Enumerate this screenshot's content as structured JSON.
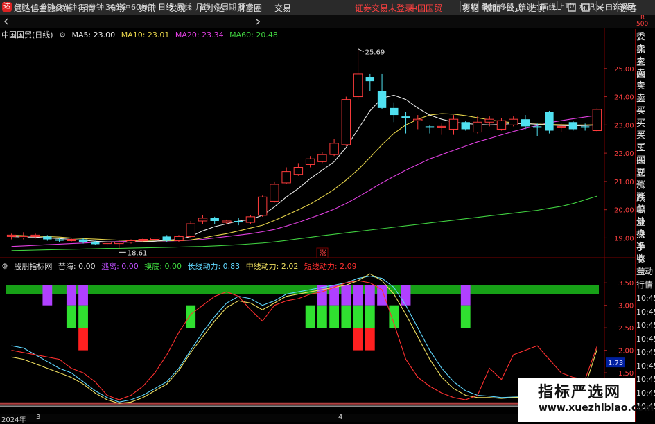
{
  "app": {
    "title": "通达信金融终端",
    "logo_text": "达"
  },
  "menu": [
    "行情",
    "市场",
    "资讯",
    "发现",
    "问小达",
    "财富圈",
    "交易"
  ],
  "menu_notice": {
    "login": "证券交易未登录",
    "stock": "中国国贸"
  },
  "menu_right": [
    "功能",
    "版面",
    "公式",
    "选项"
  ],
  "guest": "游客",
  "periods": [
    "分时",
    "1分钟",
    "5分钟",
    "15分钟",
    "30分钟",
    "60分钟",
    "日线",
    "周线",
    "月线",
    "多周期",
    "更多"
  ],
  "active_period": "日线",
  "toolbar_right": [
    "复权",
    "叠加",
    "多股",
    "统计",
    "画线",
    "F10",
    "标记",
    "+自选",
    "返回"
  ],
  "main_legend": {
    "name": "中国国贸(日线)",
    "items": [
      {
        "label": "MA5: 23.00",
        "color": "#e6e6e6"
      },
      {
        "label": "MA10: 23.01",
        "color": "#e6d34a"
      },
      {
        "label": "MA20: 23.34",
        "color": "#e040e0"
      },
      {
        "label": "MA60: 20.48",
        "color": "#40d040"
      }
    ]
  },
  "sub_legend": {
    "name": "股朋指标网",
    "items": [
      {
        "label": "苦海: 0.00",
        "color": "#d8d8d8"
      },
      {
        "label": "逃离: 0.00",
        "color": "#c050ff"
      },
      {
        "label": "摸底: 0.00",
        "color": "#40e040"
      },
      {
        "label": "长线动力: 0.83",
        "color": "#60d8ff"
      },
      {
        "label": "中线动力: 2.02",
        "color": "#f0e060"
      },
      {
        "label": "短线动力: 2.09",
        "color": "#ff3030"
      }
    ]
  },
  "right_panel": {
    "top_marks": [
      "R",
      "500"
    ],
    "items": [
      "委比",
      "卖五",
      "卖四",
      "卖三",
      "卖二",
      "卖一",
      "买一",
      "买二",
      "买三",
      "买四",
      "买五",
      "现价",
      "涨跌",
      "涨幅",
      "总量",
      "外盘",
      "换手",
      "净资",
      "收益"
    ],
    "bottom_items": [
      "自动",
      "行情"
    ],
    "times": [
      "10:45",
      "10:45",
      "10:45",
      "10:45",
      "10:45",
      "10:45",
      "10:45",
      "10:45",
      "10:45"
    ]
  },
  "price_axis": {
    "ticks": [
      "25.00",
      "24.00",
      "23.00",
      "22.00",
      "21.00",
      "20.00",
      "19.00"
    ],
    "min": 18.3,
    "max": 26.0
  },
  "annotations": {
    "high": "25.69",
    "low": "18.61",
    "marker": "涨"
  },
  "indicator_axis": {
    "ticks": [
      "3.50",
      "3.00",
      "2.50",
      "2.00",
      "1.50",
      "1.00"
    ],
    "min": 0.7,
    "max": 3.75,
    "current": "1.73"
  },
  "chart_data": {
    "type": "candlestick",
    "candles": [
      [
        19.05,
        19.1,
        18.95,
        19.15
      ],
      [
        19.0,
        19.05,
        18.95,
        19.2
      ],
      [
        19.05,
        19.1,
        18.98,
        19.15
      ],
      [
        19.05,
        18.95,
        18.9,
        19.1
      ],
      [
        18.95,
        18.9,
        18.85,
        19.0
      ],
      [
        18.9,
        18.95,
        18.85,
        19.0
      ],
      [
        18.95,
        18.85,
        18.8,
        19.0
      ],
      [
        18.85,
        18.78,
        18.75,
        18.9
      ],
      [
        18.8,
        18.85,
        18.7,
        18.9
      ],
      [
        18.8,
        18.85,
        18.61,
        18.9
      ],
      [
        18.85,
        18.9,
        18.8,
        18.95
      ],
      [
        18.9,
        18.95,
        18.85,
        19.0
      ],
      [
        18.95,
        19.0,
        18.9,
        19.05
      ],
      [
        19.05,
        18.9,
        18.85,
        19.1
      ],
      [
        18.9,
        19.05,
        18.85,
        19.1
      ],
      [
        19.05,
        19.5,
        19.0,
        19.6
      ],
      [
        19.6,
        19.7,
        19.5,
        19.8
      ],
      [
        19.7,
        19.6,
        19.5,
        19.75
      ],
      [
        19.55,
        19.6,
        19.5,
        19.65
      ],
      [
        19.6,
        19.55,
        19.45,
        19.7
      ],
      [
        19.55,
        19.75,
        19.5,
        19.8
      ],
      [
        19.8,
        20.45,
        19.75,
        20.5
      ],
      [
        20.3,
        20.9,
        20.25,
        21.0
      ],
      [
        20.95,
        21.35,
        20.9,
        21.5
      ],
      [
        21.25,
        21.5,
        21.2,
        21.65
      ],
      [
        21.6,
        21.8,
        21.5,
        21.9
      ],
      [
        21.7,
        21.95,
        21.65,
        22.05
      ],
      [
        21.95,
        22.35,
        21.9,
        22.5
      ],
      [
        22.3,
        23.9,
        22.25,
        24.0
      ],
      [
        24.0,
        24.8,
        23.9,
        25.69
      ],
      [
        24.7,
        24.55,
        24.2,
        24.8
      ],
      [
        24.2,
        23.6,
        23.55,
        24.8
      ],
      [
        23.6,
        23.35,
        23.1,
        23.8
      ],
      [
        23.3,
        23.25,
        22.7,
        23.45
      ],
      [
        23.15,
        23.2,
        22.85,
        23.35
      ],
      [
        22.95,
        22.9,
        22.7,
        23.0
      ],
      [
        22.9,
        22.95,
        22.65,
        23.05
      ],
      [
        22.85,
        23.2,
        22.65,
        23.35
      ],
      [
        23.1,
        22.85,
        22.8,
        23.15
      ],
      [
        22.75,
        23.1,
        22.7,
        23.3
      ],
      [
        23.1,
        23.2,
        22.95,
        23.3
      ],
      [
        22.85,
        23.15,
        22.8,
        23.25
      ],
      [
        23.0,
        23.2,
        22.95,
        23.3
      ],
      [
        23.2,
        22.95,
        22.85,
        23.35
      ],
      [
        22.95,
        22.9,
        22.6,
        23.05
      ],
      [
        23.45,
        22.8,
        22.7,
        23.5
      ],
      [
        22.9,
        22.95,
        22.75,
        23.05
      ],
      [
        23.1,
        22.85,
        22.8,
        23.15
      ],
      [
        22.95,
        22.9,
        22.8,
        23.05
      ],
      [
        22.8,
        23.55,
        22.75,
        23.6
      ]
    ],
    "candles_format": [
      "open",
      "close",
      "low",
      "high"
    ],
    "ma5": [
      19.05,
      19.03,
      19.03,
      19.0,
      18.98,
      18.95,
      18.92,
      18.88,
      18.86,
      18.85,
      18.85,
      18.86,
      18.88,
      18.92,
      18.95,
      19.05,
      19.25,
      19.4,
      19.5,
      19.6,
      19.65,
      19.8,
      20.1,
      20.45,
      20.75,
      21.1,
      21.4,
      21.7,
      22.2,
      22.85,
      23.5,
      23.95,
      24.05,
      23.9,
      23.6,
      23.35,
      23.2,
      23.1,
      23.05,
      23.02,
      23.0,
      23.02,
      23.05,
      23.05,
      23.02,
      23.0,
      22.98,
      22.97,
      22.98,
      23.0
    ],
    "ma10": [
      19.1,
      19.08,
      19.06,
      19.05,
      19.03,
      19.0,
      18.98,
      18.96,
      18.94,
      18.92,
      18.9,
      18.89,
      18.89,
      18.9,
      18.9,
      18.93,
      19.0,
      19.08,
      19.15,
      19.25,
      19.35,
      19.45,
      19.62,
      19.8,
      20.0,
      20.2,
      20.45,
      20.72,
      21.05,
      21.42,
      21.85,
      22.3,
      22.7,
      23.0,
      23.2,
      23.35,
      23.4,
      23.38,
      23.33,
      23.25,
      23.18,
      23.12,
      23.08,
      23.05,
      23.03,
      23.02,
      23.01,
      23.0,
      23.0,
      23.01
    ],
    "ma20": [
      18.7,
      18.72,
      18.74,
      18.76,
      18.78,
      18.8,
      18.82,
      18.84,
      18.86,
      18.87,
      18.88,
      18.88,
      18.89,
      18.89,
      18.9,
      18.92,
      18.95,
      19.0,
      19.05,
      19.1,
      19.15,
      19.22,
      19.3,
      19.42,
      19.55,
      19.7,
      19.85,
      20.02,
      20.22,
      20.45,
      20.7,
      20.95,
      21.18,
      21.4,
      21.6,
      21.8,
      21.95,
      22.1,
      22.25,
      22.4,
      22.52,
      22.65,
      22.77,
      22.88,
      22.98,
      23.08,
      23.15,
      23.22,
      23.28,
      23.34
    ],
    "ma60": [
      18.55,
      18.56,
      18.57,
      18.58,
      18.59,
      18.6,
      18.61,
      18.62,
      18.63,
      18.63,
      18.64,
      18.65,
      18.66,
      18.67,
      18.68,
      18.69,
      18.7,
      18.72,
      18.74,
      18.76,
      18.79,
      18.82,
      18.86,
      18.91,
      18.97,
      19.02,
      19.08,
      19.13,
      19.18,
      19.23,
      19.28,
      19.33,
      19.38,
      19.43,
      19.48,
      19.53,
      19.58,
      19.63,
      19.68,
      19.73,
      19.78,
      19.83,
      19.88,
      19.93,
      19.98,
      20.05,
      20.12,
      20.22,
      20.35,
      20.48
    ],
    "long_line": [
      2.1,
      2.05,
      1.9,
      1.75,
      1.6,
      1.5,
      1.3,
      1.1,
      0.95,
      0.85,
      0.9,
      1.0,
      1.15,
      1.3,
      1.6,
      2.0,
      2.4,
      2.75,
      3.05,
      3.2,
      3.15,
      3.0,
      3.1,
      3.25,
      3.3,
      3.35,
      3.4,
      3.45,
      3.5,
      3.6,
      3.65,
      3.6,
      3.4,
      3.0,
      2.5,
      2.0,
      1.6,
      1.3,
      1.1,
      1.0,
      0.98,
      0.95,
      0.96,
      0.97,
      1.0,
      1.02,
      1.05,
      0.98,
      0.98,
      0.83
    ],
    "mid_line": [
      1.85,
      1.8,
      1.7,
      1.6,
      1.5,
      1.4,
      1.25,
      1.05,
      0.9,
      0.82,
      0.85,
      0.95,
      1.1,
      1.25,
      1.55,
      1.95,
      2.3,
      2.65,
      2.95,
      3.1,
      3.05,
      2.9,
      3.05,
      3.2,
      3.25,
      3.3,
      3.35,
      3.4,
      3.45,
      3.55,
      3.7,
      3.55,
      3.25,
      2.8,
      2.3,
      1.8,
      1.4,
      1.15,
      1.0,
      0.95,
      0.95,
      0.93,
      0.95,
      0.96,
      0.98,
      1.0,
      1.05,
      1.1,
      1.2,
      2.02
    ],
    "short_line": [
      2.0,
      1.95,
      1.9,
      1.85,
      1.8,
      1.6,
      1.5,
      1.3,
      1.0,
      0.9,
      1.0,
      1.2,
      1.5,
      1.9,
      2.4,
      2.8,
      3.0,
      3.2,
      3.3,
      3.2,
      2.9,
      2.65,
      3.0,
      3.1,
      3.15,
      3.25,
      3.3,
      3.4,
      3.5,
      3.55,
      3.5,
      3.35,
      2.6,
      1.8,
      1.4,
      1.2,
      1.05,
      0.95,
      0.9,
      1.0,
      1.6,
      1.35,
      1.9,
      2.0,
      2.1,
      1.8,
      1.5,
      1.4,
      1.35,
      2.09
    ],
    "escape_bars": [
      3,
      5,
      6,
      26,
      27,
      28,
      29,
      30,
      31,
      33,
      38
    ],
    "bottom_bars": [
      5,
      6,
      15,
      25,
      26,
      27,
      28,
      29,
      30,
      32,
      38
    ],
    "red_bars": [
      6,
      29,
      30
    ]
  },
  "timeline": {
    "year_label": "2024年",
    "month_1": "3",
    "month_2": "4"
  },
  "watermark": {
    "title": "指标严选网",
    "url": "www.xuezhibiao.com"
  }
}
